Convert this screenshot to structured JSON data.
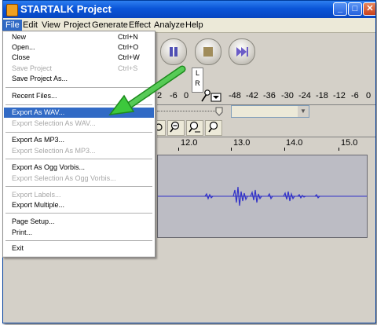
{
  "window": {
    "title": "STARTALK Project",
    "minimize": "_",
    "maximize": "□",
    "close": "✕"
  },
  "menubar": [
    "File",
    "Edit",
    "View",
    "Project",
    "Generate",
    "Effect",
    "Analyze",
    "Help"
  ],
  "file_menu": [
    {
      "label": "New",
      "shortcut": "Ctrl+N",
      "enabled": true
    },
    {
      "label": "Open...",
      "shortcut": "Ctrl+O",
      "enabled": true
    },
    {
      "label": "Close",
      "shortcut": "Ctrl+W",
      "enabled": true
    },
    {
      "label": "Save Project",
      "shortcut": "Ctrl+S",
      "enabled": false
    },
    {
      "label": "Save Project As...",
      "shortcut": "",
      "enabled": true
    },
    {
      "label": "Recent Files...",
      "shortcut": "",
      "enabled": true,
      "submenu": true
    },
    {
      "label": "Export As WAV...",
      "shortcut": "",
      "enabled": true,
      "selected": true
    },
    {
      "label": "Export Selection As WAV...",
      "shortcut": "",
      "enabled": false
    },
    {
      "label": "Export As MP3...",
      "shortcut": "",
      "enabled": true
    },
    {
      "label": "Export Selection As MP3...",
      "shortcut": "",
      "enabled": false
    },
    {
      "label": "Export As Ogg Vorbis...",
      "shortcut": "",
      "enabled": true
    },
    {
      "label": "Export Selection As Ogg Vorbis...",
      "shortcut": "",
      "enabled": false
    },
    {
      "label": "Export Labels...",
      "shortcut": "",
      "enabled": false
    },
    {
      "label": "Export Multiple...",
      "shortcut": "",
      "enabled": true
    },
    {
      "label": "Page Setup...",
      "shortcut": "",
      "enabled": true
    },
    {
      "label": "Print...",
      "shortcut": "",
      "enabled": true
    },
    {
      "label": "Exit",
      "shortcut": "",
      "enabled": true
    }
  ],
  "meter": {
    "lr_l": "L",
    "lr_r": "R",
    "left_scale": [
      "2",
      "-6",
      "0"
    ],
    "right_scale": [
      "-48",
      "-42",
      "-36",
      "-30",
      "-24",
      "-18",
      "-12",
      "-6",
      "0"
    ]
  },
  "ruler": [
    "12.0",
    "13.0",
    "14.0",
    "15.0"
  ],
  "icons": {
    "pause": "pause-icon",
    "stop": "stop-icon",
    "skip_end": "skip-to-end-icon",
    "mic": "microphone-icon"
  },
  "colors": {
    "title_bar": "#0a55d8",
    "selection": "#316ac5",
    "waveform": "#3232c8",
    "annotation_arrow": "#3cc83c"
  }
}
